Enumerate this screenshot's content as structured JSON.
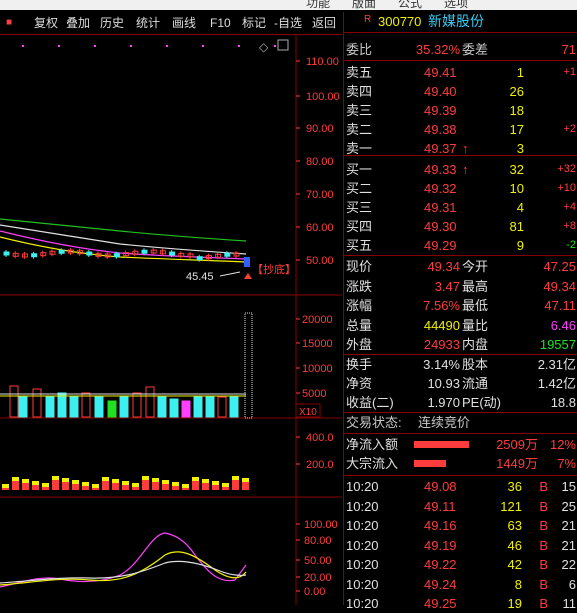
{
  "top_menu": [
    "功能",
    "版面",
    "公式",
    "选项"
  ],
  "toolbar": {
    "items": [
      "复权",
      "叠加",
      "历史",
      "统计",
      "画线",
      "F10",
      "标记",
      "-自选",
      "返回"
    ]
  },
  "price_axis": [
    "110.00",
    "100.00",
    "90.00",
    "80.00",
    "70.00",
    "60.00",
    "50.00"
  ],
  "volume_axis": [
    "20000",
    "15000",
    "10000",
    "5000"
  ],
  "volume_multiplier": "X10",
  "flow_axis": [
    "400.0",
    "200.0"
  ],
  "kdj_axis": [
    "100.00",
    "80.00",
    "50.00",
    "20.00",
    "0.00"
  ],
  "chart_annotations": {
    "low_price": "45.45",
    "signal": "【抄底】"
  },
  "stock": {
    "badge": "R",
    "code": "300770",
    "name": "新媒股份"
  },
  "weibi": {
    "label": "委比",
    "value": "35.32%",
    "label2": "委差",
    "value2": "71"
  },
  "sell": [
    {
      "label": "卖五",
      "price": "49.41",
      "vol": "1",
      "chg": "+1"
    },
    {
      "label": "卖四",
      "price": "49.40",
      "vol": "26",
      "chg": ""
    },
    {
      "label": "卖三",
      "price": "49.39",
      "vol": "18",
      "chg": ""
    },
    {
      "label": "卖二",
      "price": "49.38",
      "vol": "17",
      "chg": "+2"
    },
    {
      "label": "卖一",
      "price": "49.37",
      "vol": "3",
      "chg": "",
      "arrow": "↑"
    }
  ],
  "buy": [
    {
      "label": "买一",
      "price": "49.33",
      "vol": "32",
      "chg": "+32",
      "arrow": "↑"
    },
    {
      "label": "买二",
      "price": "49.32",
      "vol": "10",
      "chg": "+10"
    },
    {
      "label": "买三",
      "price": "49.31",
      "vol": "4",
      "chg": "+4"
    },
    {
      "label": "买四",
      "price": "49.30",
      "vol": "81",
      "chg": "+8"
    },
    {
      "label": "买五",
      "price": "49.29",
      "vol": "9",
      "chg": "-2"
    }
  ],
  "quote": {
    "xianjia_l": "现价",
    "xianjia": "49.34",
    "jinkai_l": "今开",
    "jinkai": "47.25",
    "zhangdie_l": "涨跌",
    "zhangdie": "3.47",
    "zuigao_l": "最高",
    "zuigao": "49.34",
    "zhangfu_l": "涨幅",
    "zhangfu": "7.56%",
    "zuidi_l": "最低",
    "zuidi": "47.11",
    "zongliang_l": "总量",
    "zongliang": "44490",
    "liangbi_l": "量比",
    "liangbi": "6.46",
    "waipan_l": "外盘",
    "waipan": "24933",
    "neipan_l": "内盘",
    "neipan": "19557"
  },
  "stats": {
    "huanshou_l": "换手",
    "huanshou": "3.14%",
    "guben_l": "股本",
    "guben": "2.31亿",
    "jingzi_l": "净资",
    "jingzi": "10.93",
    "liutong_l": "流通",
    "liutong": "1.42亿",
    "shouyi_l": "收益(二)",
    "shouyi": "1.970",
    "pe_l": "PE(动)",
    "pe": "18.8"
  },
  "trade_status": {
    "label": "交易状态:",
    "value": "连续竞价"
  },
  "flows": [
    {
      "label": "净流入额",
      "value": "2509万",
      "pct": "12%",
      "fill": 0.12
    },
    {
      "label": "大宗流入",
      "value": "1449万",
      "pct": "7%",
      "fill": 0.07
    }
  ],
  "ticks": [
    {
      "time": "10:20",
      "price": "49.08",
      "vol": "36",
      "side": "B",
      "n": "15"
    },
    {
      "time": "10:20",
      "price": "49.11",
      "vol": "121",
      "side": "B",
      "n": "25"
    },
    {
      "time": "10:20",
      "price": "49.16",
      "vol": "63",
      "side": "B",
      "n": "21"
    },
    {
      "time": "10:20",
      "price": "49.19",
      "vol": "46",
      "side": "B",
      "n": "21"
    },
    {
      "time": "10:20",
      "price": "49.22",
      "vol": "42",
      "side": "B",
      "n": "22"
    },
    {
      "time": "10:20",
      "price": "49.24",
      "vol": "8",
      "side": "B",
      "n": "6"
    },
    {
      "time": "10:20",
      "price": "49.25",
      "vol": "19",
      "side": "B",
      "n": "11"
    }
  ],
  "colors": {
    "up": "#ff3c3c",
    "down": "#20e020",
    "ma": "#e0e0e0",
    "yellow": "#f0f000",
    "magenta": "#ff40ff",
    "cyan": "#3cf0f0"
  }
}
